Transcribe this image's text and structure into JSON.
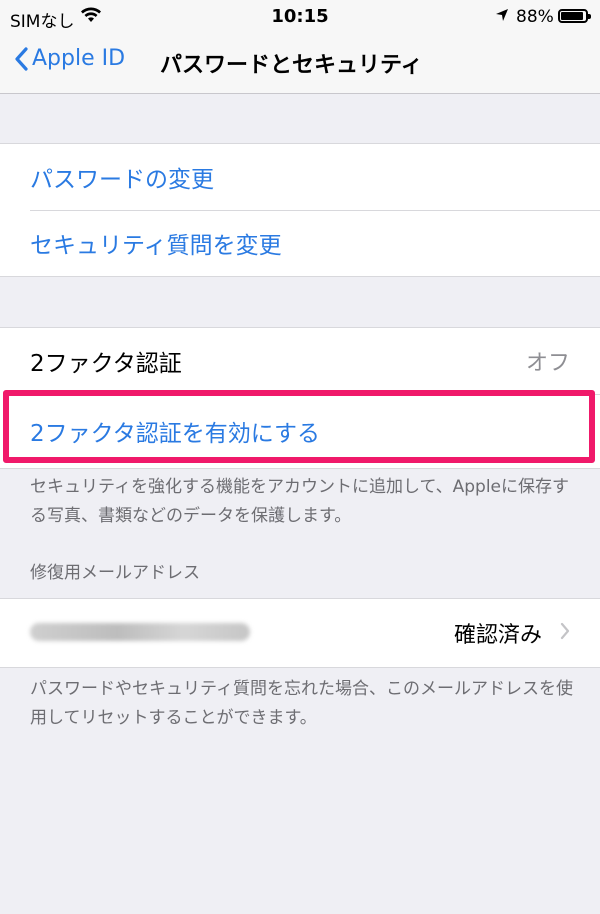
{
  "status_bar": {
    "carrier": "SIMなし",
    "time": "10:15",
    "battery_pct": "88%"
  },
  "nav": {
    "back_label": "Apple ID",
    "title": "パスワードとセキュリティ"
  },
  "password_group": {
    "change_password": "パスワードの変更",
    "change_security_questions": "セキュリティ質問を変更"
  },
  "two_factor": {
    "label": "2ファクタ認証",
    "value": "オフ",
    "enable_link": "2ファクタ認証を有効にする",
    "description": "セキュリティを強化する機能をアカウントに追加して、Appleに保存する写真、書類などのデータを保護します。"
  },
  "rescue_email": {
    "header": "修復用メールアドレス",
    "status": "確認済み",
    "footer": "パスワードやセキュリティ質問を忘れた場合、このメールアドレスを使用してリセットすることができます。"
  },
  "colors": {
    "accent": "#2a7ae2",
    "highlight": "#f0196a"
  }
}
